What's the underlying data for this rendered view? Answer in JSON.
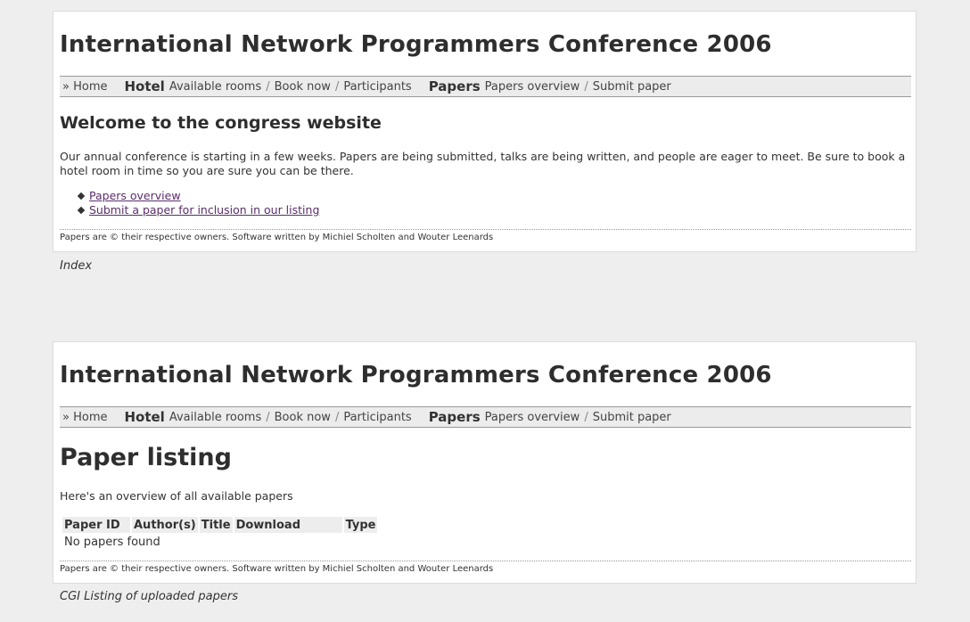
{
  "screenshots": [
    {
      "site_title": "International Network Programmers Conference 2006",
      "nav": {
        "home": "» Home",
        "hotel_head": "Hotel",
        "hotel_items": [
          "Available rooms",
          "Book now",
          "Participants"
        ],
        "papers_head": "Papers",
        "papers_items": [
          "Papers overview",
          "Submit paper"
        ]
      },
      "heading": "Welcome to the congress website",
      "intro": "Our annual conference is starting in a few weeks. Papers are being submitted, talks are being written, and people are eager to meet. Be sure to book a hotel room in time so you are sure you can be there.",
      "links": [
        "Papers overview",
        "Submit a paper for inclusion in our listing"
      ],
      "footer": "Papers are © their respective owners. Software written by Michiel Scholten and Wouter Leenards",
      "caption": "Index"
    },
    {
      "site_title": "International Network Programmers Conference 2006",
      "nav": {
        "home": "» Home",
        "hotel_head": "Hotel",
        "hotel_items": [
          "Available rooms",
          "Book now",
          "Participants"
        ],
        "papers_head": "Papers",
        "papers_items": [
          "Papers overview",
          "Submit paper"
        ]
      },
      "heading": "Paper listing",
      "overview_text": "Here's an overview of all available papers",
      "table": {
        "columns": [
          "Paper ID",
          "Author(s)",
          "Title",
          "Download",
          "Type"
        ],
        "empty_message": "No papers found"
      },
      "footer": "Papers are © their respective owners. Software written by Michiel Scholten and Wouter Leenards",
      "caption": "CGI Listing of uploaded papers"
    }
  ],
  "colors": {
    "background": "#eeeeee",
    "panel": "#ffffff",
    "nav_bg": "#ececec",
    "link_visited": "#5a2d6b",
    "text": "#333333"
  }
}
